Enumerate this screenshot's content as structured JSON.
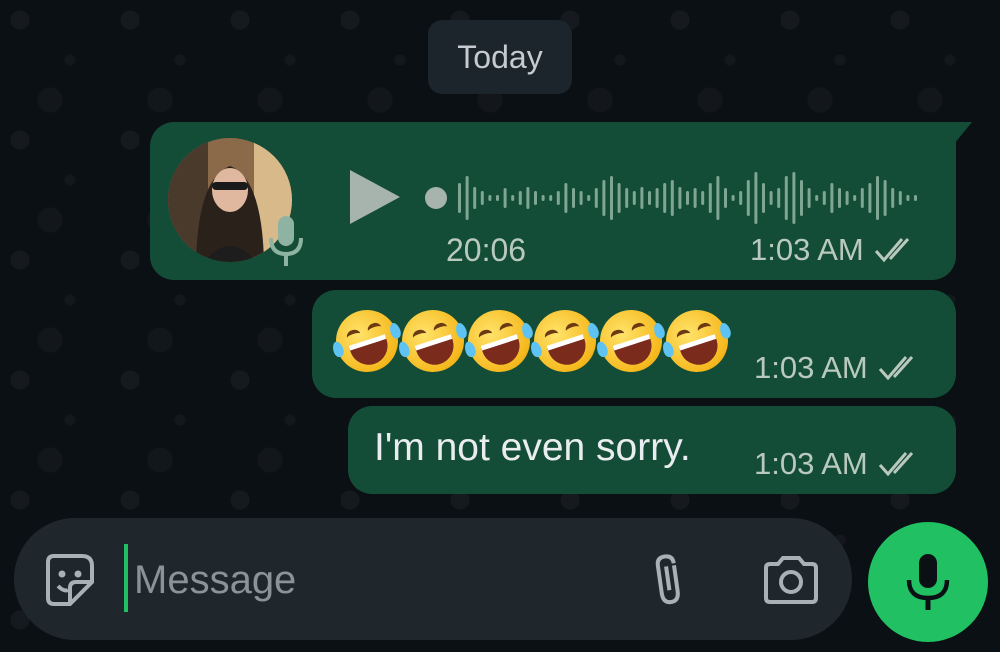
{
  "date_separator": "Today",
  "messages": [
    {
      "type": "voice",
      "duration": "20:06",
      "time": "1:03 AM",
      "status_icon": "double-check-icon",
      "avatar_icon": "avatar-photo"
    },
    {
      "type": "emoji",
      "emoji": "rolling-on-floor-laughing",
      "count": 6,
      "time": "1:03 AM",
      "status_icon": "double-check-icon"
    },
    {
      "type": "text",
      "text": "I'm not even sorry.",
      "time": "1:03 AM",
      "status_icon": "double-check-icon"
    }
  ],
  "composer": {
    "placeholder": "Message",
    "value": "",
    "icons": [
      "sticker-icon",
      "paperclip-icon",
      "camera-icon",
      "microphone-icon"
    ]
  },
  "colors": {
    "background": "#0b1014",
    "outgoing_bubble": "#144d37",
    "composer_bg": "#1f272c",
    "accent": "#21c063",
    "meta_text": "#b9c9c0"
  }
}
